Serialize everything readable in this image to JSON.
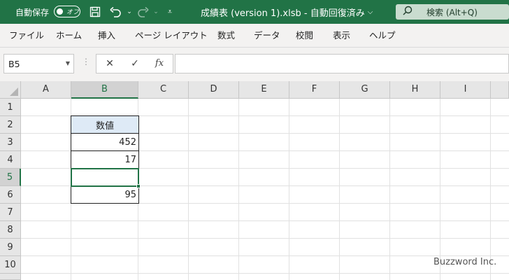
{
  "titlebar": {
    "autosave_label": "自動保存",
    "autosave_state": "オフ",
    "icons": [
      "save-icon",
      "undo-icon",
      "redo-icon",
      "customize-icon"
    ],
    "document_title": "成績表 (version 1).xlsb  -  自動回復済み",
    "search_placeholder": "検索 (Alt+Q)"
  },
  "menu": {
    "items": [
      "ファイル",
      "ホーム",
      "挿入",
      "ページ レイアウト",
      "数式",
      "データ",
      "校閲",
      "表示",
      "ヘルプ"
    ]
  },
  "formula_bar": {
    "name_box": "B5",
    "fx_label": "fx",
    "formula": ""
  },
  "grid": {
    "columns": [
      "A",
      "B",
      "C",
      "D",
      "E",
      "F",
      "G",
      "H",
      "I"
    ],
    "rows": [
      "1",
      "2",
      "3",
      "4",
      "5",
      "6",
      "7",
      "8",
      "9",
      "10"
    ],
    "selected_column": "B",
    "selected_row": "5"
  },
  "cells": {
    "B2": "数値",
    "B3": "452",
    "B4": "17",
    "B5": "",
    "B6": "95"
  },
  "watermark": "Buzzword Inc.",
  "colors": {
    "accent": "#217346",
    "header_fill": "#deeaf6"
  }
}
